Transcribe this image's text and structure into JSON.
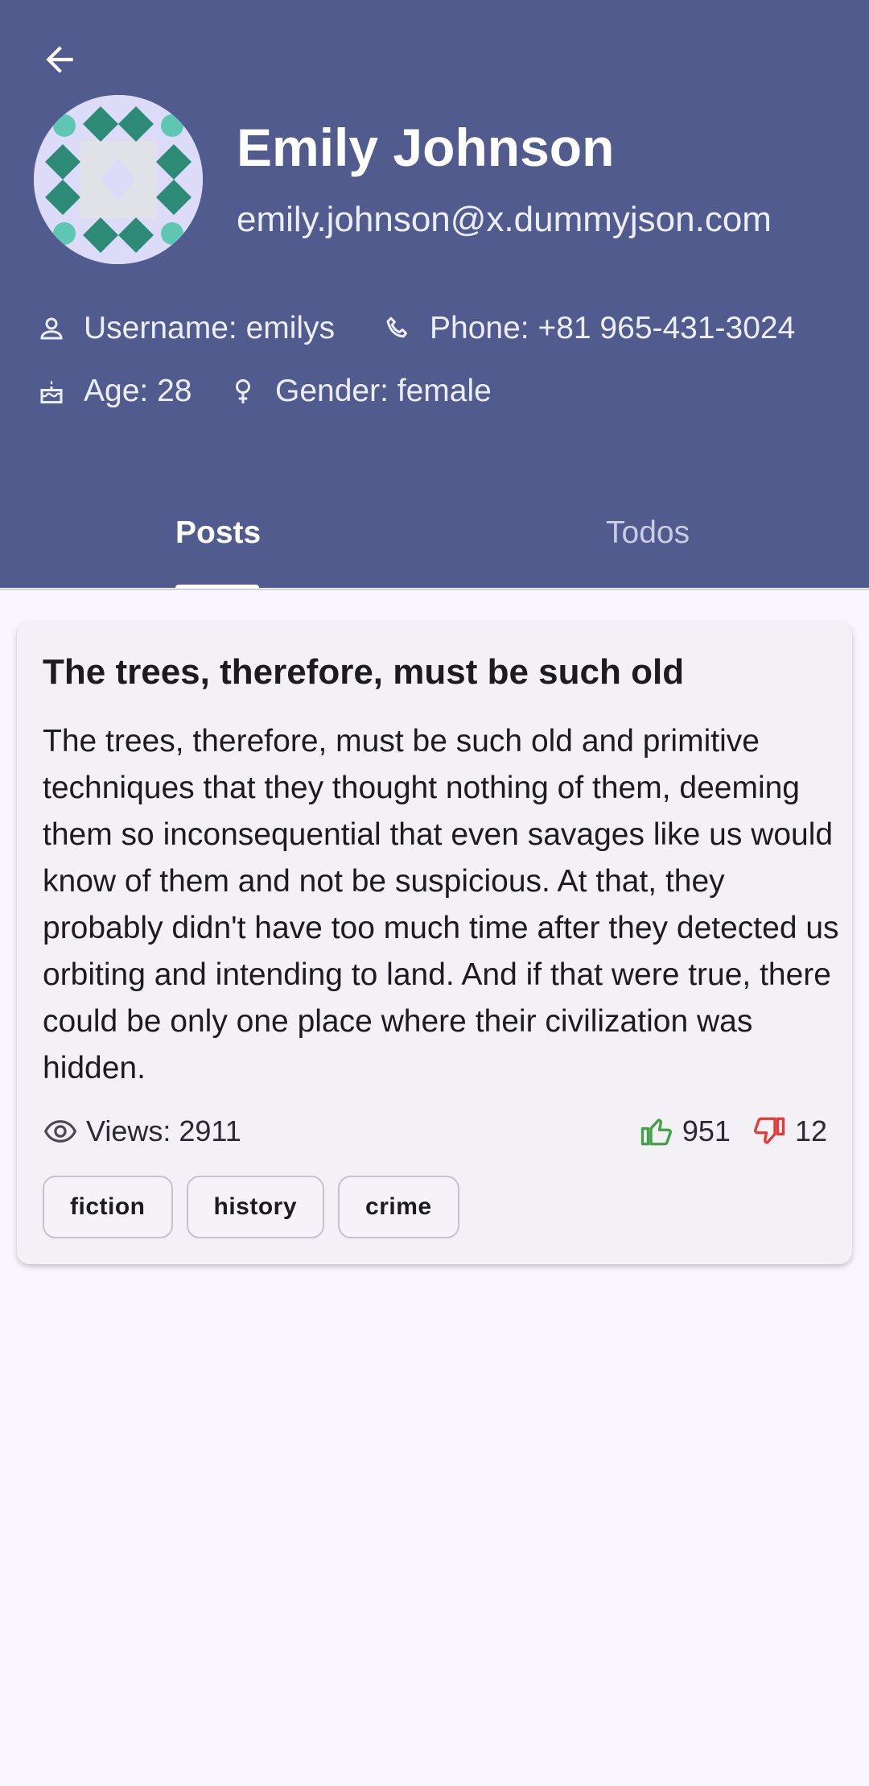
{
  "profile": {
    "name": "Emily Johnson",
    "email": "emily.johnson@x.dummyjson.com",
    "username": "Username: emilys",
    "phone": "Phone: +81 965-431-3024",
    "age": "Age: 28",
    "gender": "Gender: female"
  },
  "tabs": [
    {
      "label": "Posts",
      "selected": true
    },
    {
      "label": "Todos",
      "selected": false
    }
  ],
  "post": {
    "title": "The trees, therefore, must be such old",
    "body": "The trees, therefore, must be such old and primitive techniques that they thought nothing of them, deeming them so inconsequential that even savages like us would know of them and not be suspicious. At that, they probably didn't have too much time after they detected us orbiting and intending to land. And if that were true, there could be only one place where their civilization was hidden.",
    "views": "Views: 2911",
    "likes": "951",
    "dislikes": "12",
    "tags": [
      "fiction",
      "history",
      "crime"
    ]
  },
  "colors": {
    "header": "#525b8e",
    "background": "#f9f6fd",
    "card": "#f3f0f6",
    "like": "#43a047",
    "dislike": "#e53935"
  },
  "icons": {
    "back": "arrow-left-icon",
    "username": "person-icon",
    "phone": "phone-icon",
    "age": "cake-icon",
    "gender": "female-icon",
    "views": "eye-icon",
    "likes": "thumb-up-icon",
    "dislikes": "thumb-down-icon"
  }
}
